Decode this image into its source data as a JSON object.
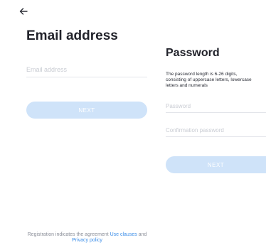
{
  "nav": {
    "back_icon": "arrow-left-icon"
  },
  "email_step": {
    "title": "Email address",
    "email_placeholder": "Email address",
    "next_label": "NEXT"
  },
  "password_step": {
    "title": "Password",
    "description_lines": [
      "The password length is 6-26 digits,",
      "consisting of uppercase letters, lowercase",
      "letters and numerals"
    ],
    "password_placeholder": "Password",
    "confirm_placeholder": "Confirmation password",
    "next_label": "NEXT"
  },
  "footer": {
    "text_before": "Registration indicates the agreement ",
    "use_clauses_label": "Use clauses",
    "text_and": " and",
    "privacy_policy_label": "Privacy policy"
  },
  "colors": {
    "accent": "#3c8ee8",
    "button_disabled": "#cfe3f9",
    "title_text": "#22232b",
    "placeholder": "#c9ccd3"
  }
}
